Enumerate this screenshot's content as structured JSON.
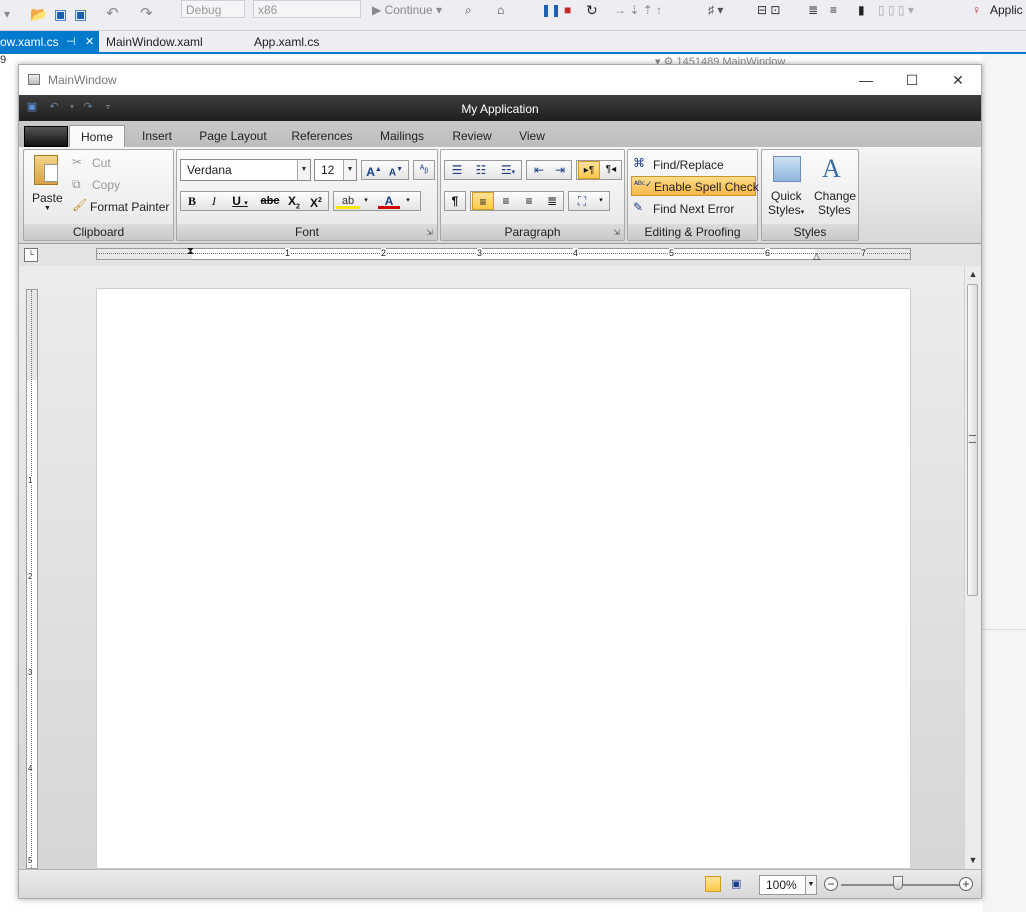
{
  "vs": {
    "toolbar": {
      "config_value": "Debug",
      "platform_value": "x86",
      "continue_label": "Continue",
      "app_label": "Applic"
    },
    "tabs": [
      {
        "label": "ow.xaml.cs",
        "pin": "⊣",
        "close": "✕"
      },
      {
        "label": "MainWindow.xaml"
      },
      {
        "label": "App.xaml.cs"
      }
    ],
    "line_fragment": "9",
    "bg_window_fragment": "1451489 MainWindow"
  },
  "window": {
    "title": "MainWindow",
    "controls": {
      "minimize": "—",
      "maximize": "☐",
      "close": "✕"
    }
  },
  "ribbon": {
    "app_title": "My Application",
    "tabs": [
      "Home",
      "Insert",
      "Page Layout",
      "References",
      "Mailings",
      "Review",
      "View"
    ],
    "active_tab": "Home",
    "clipboard": {
      "label": "Clipboard",
      "paste": "Paste",
      "cut": "Cut",
      "copy": "Copy",
      "format_painter": "Format Painter"
    },
    "font": {
      "label": "Font",
      "family": "Verdana",
      "size": "12"
    },
    "paragraph": {
      "label": "Paragraph"
    },
    "editing": {
      "label": "Editing & Proofing",
      "find_replace": "Find/Replace",
      "spell_check": "Enable Spell Check",
      "find_next_error": "Find Next Error"
    },
    "styles": {
      "label": "Styles",
      "quick_styles_line1": "Quick",
      "quick_styles_line2": "Styles",
      "change_styles_line1": "Change",
      "change_styles_line2": "Styles"
    }
  },
  "ruler": {
    "h_numbers": [
      "1",
      "2",
      "3",
      "4",
      "5",
      "6",
      "7"
    ],
    "v_numbers": [
      "1",
      "2",
      "3",
      "4",
      "5"
    ]
  },
  "status": {
    "zoom": "100%"
  }
}
